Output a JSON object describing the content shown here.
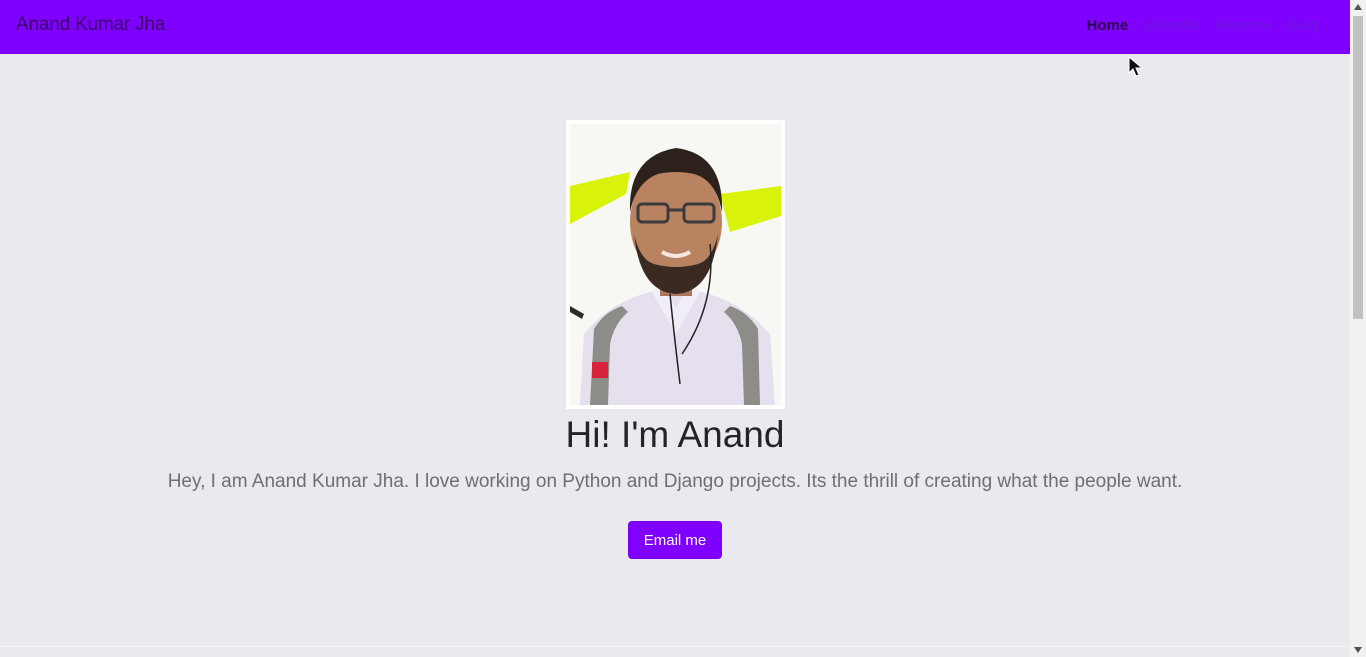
{
  "navbar": {
    "brand": "Anand Kumar Jha",
    "links": [
      {
        "label": "Home",
        "active": true
      },
      {
        "label": "Linkedin",
        "active": false
      },
      {
        "label": "Resume",
        "active": false
      },
      {
        "label": "Blog",
        "active": false
      }
    ],
    "color": "#8000ff"
  },
  "hero": {
    "photo_alt": "profile-photo",
    "title": "Hi! I'm Anand",
    "subtitle": "Hey, I am Anand Kumar Jha. I love working on Python and Django projects. Its the thrill of creating what the people want.",
    "button_label": "Email me"
  },
  "colors": {
    "accent": "#8000ff",
    "background": "#e9eaee"
  }
}
